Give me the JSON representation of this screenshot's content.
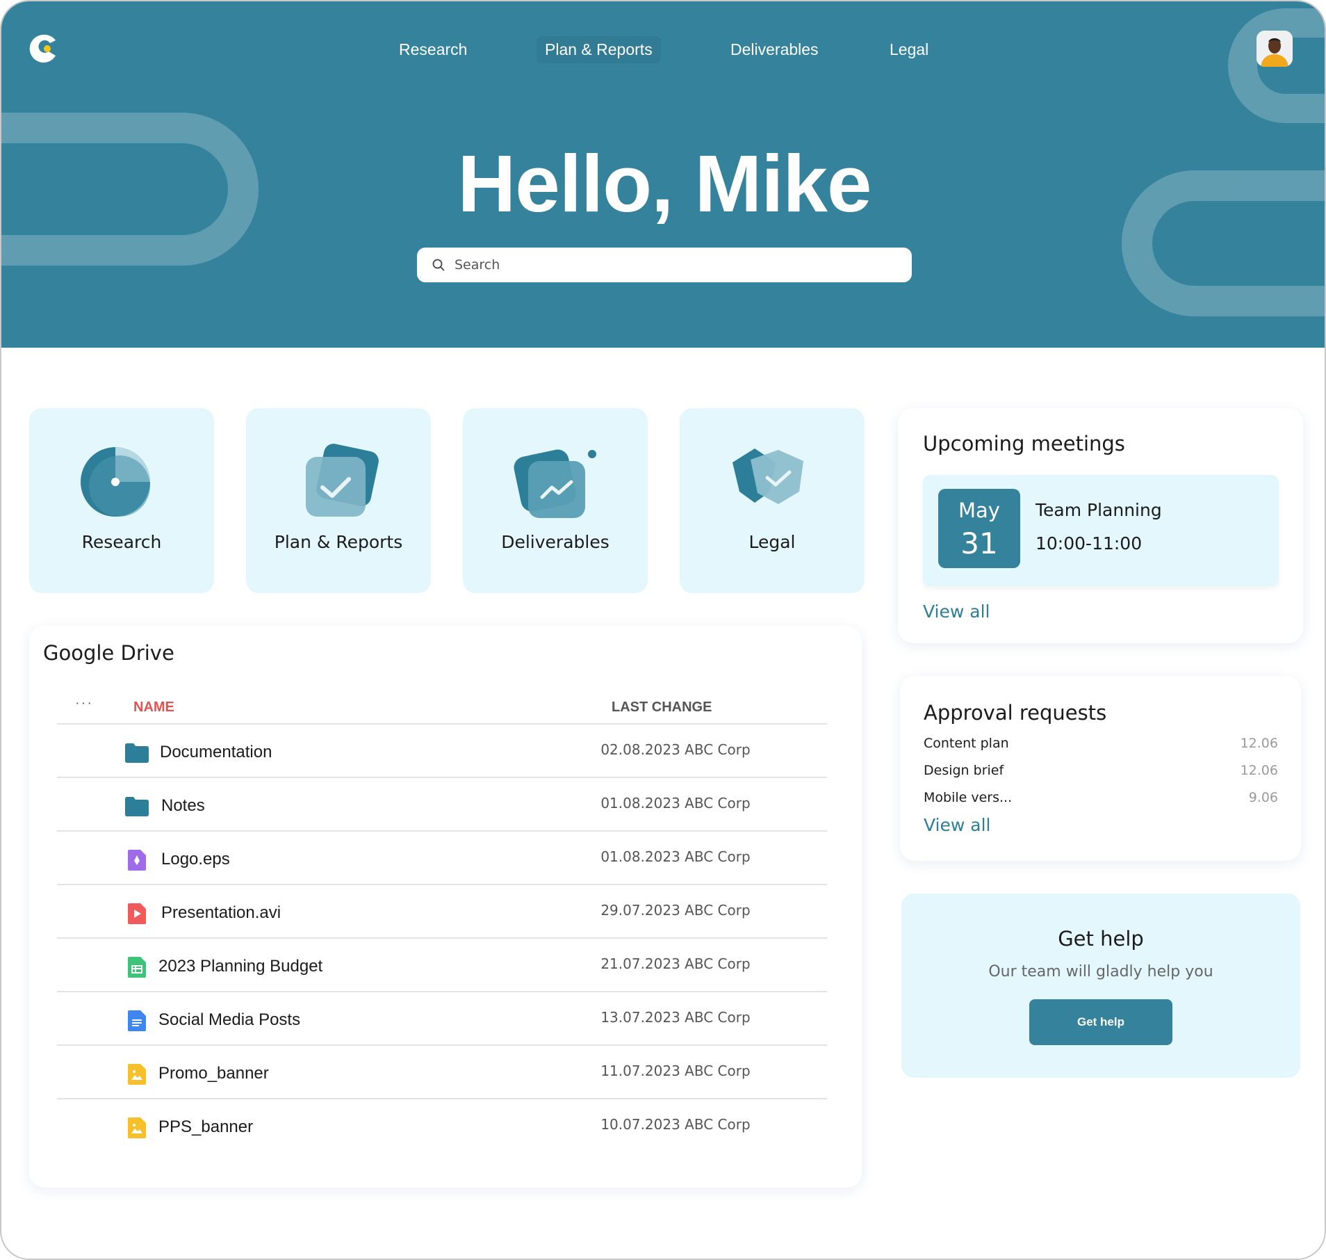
{
  "nav": {
    "items": [
      {
        "label": "Research"
      },
      {
        "label": "Plan & Reports"
      },
      {
        "label": "Deliverables"
      },
      {
        "label": "Legal"
      }
    ]
  },
  "hero": {
    "greeting": "Hello, Mike",
    "search_placeholder": "Search"
  },
  "tiles": [
    {
      "label": "Research",
      "icon": "pie-chart-icon"
    },
    {
      "label": "Plan & Reports",
      "icon": "checklist-icon"
    },
    {
      "label": "Deliverables",
      "icon": "trend-chart-icon"
    },
    {
      "label": "Legal",
      "icon": "shield-check-icon"
    }
  ],
  "drive": {
    "title": "Google Drive",
    "menu_label": "···",
    "col_name": "NAME",
    "col_last_change": "LAST CHANGE",
    "files": [
      {
        "name": "Documentation",
        "last_change": "02.08.2023 ABC Corp",
        "icon": "folder-icon"
      },
      {
        "name": "Notes",
        "last_change": "01.08.2023 ABC Corp",
        "icon": "folder-icon"
      },
      {
        "name": "Logo.eps",
        "last_change": "01.08.2023 ABC Corp",
        "icon": "vector-file-icon"
      },
      {
        "name": "Presentation.avi",
        "last_change": "29.07.2023 ABC Corp",
        "icon": "video-file-icon"
      },
      {
        "name": "2023 Planning Budget",
        "last_change": "21.07.2023 ABC Corp",
        "icon": "sheet-file-icon"
      },
      {
        "name": "Social Media Posts",
        "last_change": "13.07.2023 ABC Corp",
        "icon": "doc-file-icon"
      },
      {
        "name": "Promo_banner",
        "last_change": "11.07.2023 ABC Corp",
        "icon": "image-file-icon"
      },
      {
        "name": "PPS_banner",
        "last_change": "10.07.2023 ABC Corp",
        "icon": "image-file-icon"
      }
    ]
  },
  "meetings": {
    "title": "Upcoming meetings",
    "items": [
      {
        "month": "May",
        "day": "31",
        "name": "Team Planning",
        "time": "10:00-11:00"
      }
    ],
    "view_all": "View all"
  },
  "approvals": {
    "title": "Approval requests",
    "items": [
      {
        "name": "Content plan",
        "date": "12.06"
      },
      {
        "name": "Design brief",
        "date": "12.06"
      },
      {
        "name": "Mobile vers...",
        "date": "9.06"
      }
    ],
    "view_all": "View all"
  },
  "help": {
    "title": "Get help",
    "subtitle": "Our team will gladly help you",
    "button": "Get help"
  },
  "colors": {
    "brand": "#35829c",
    "tile_bg": "#e3f7fd",
    "accent_red": "#e45353"
  }
}
